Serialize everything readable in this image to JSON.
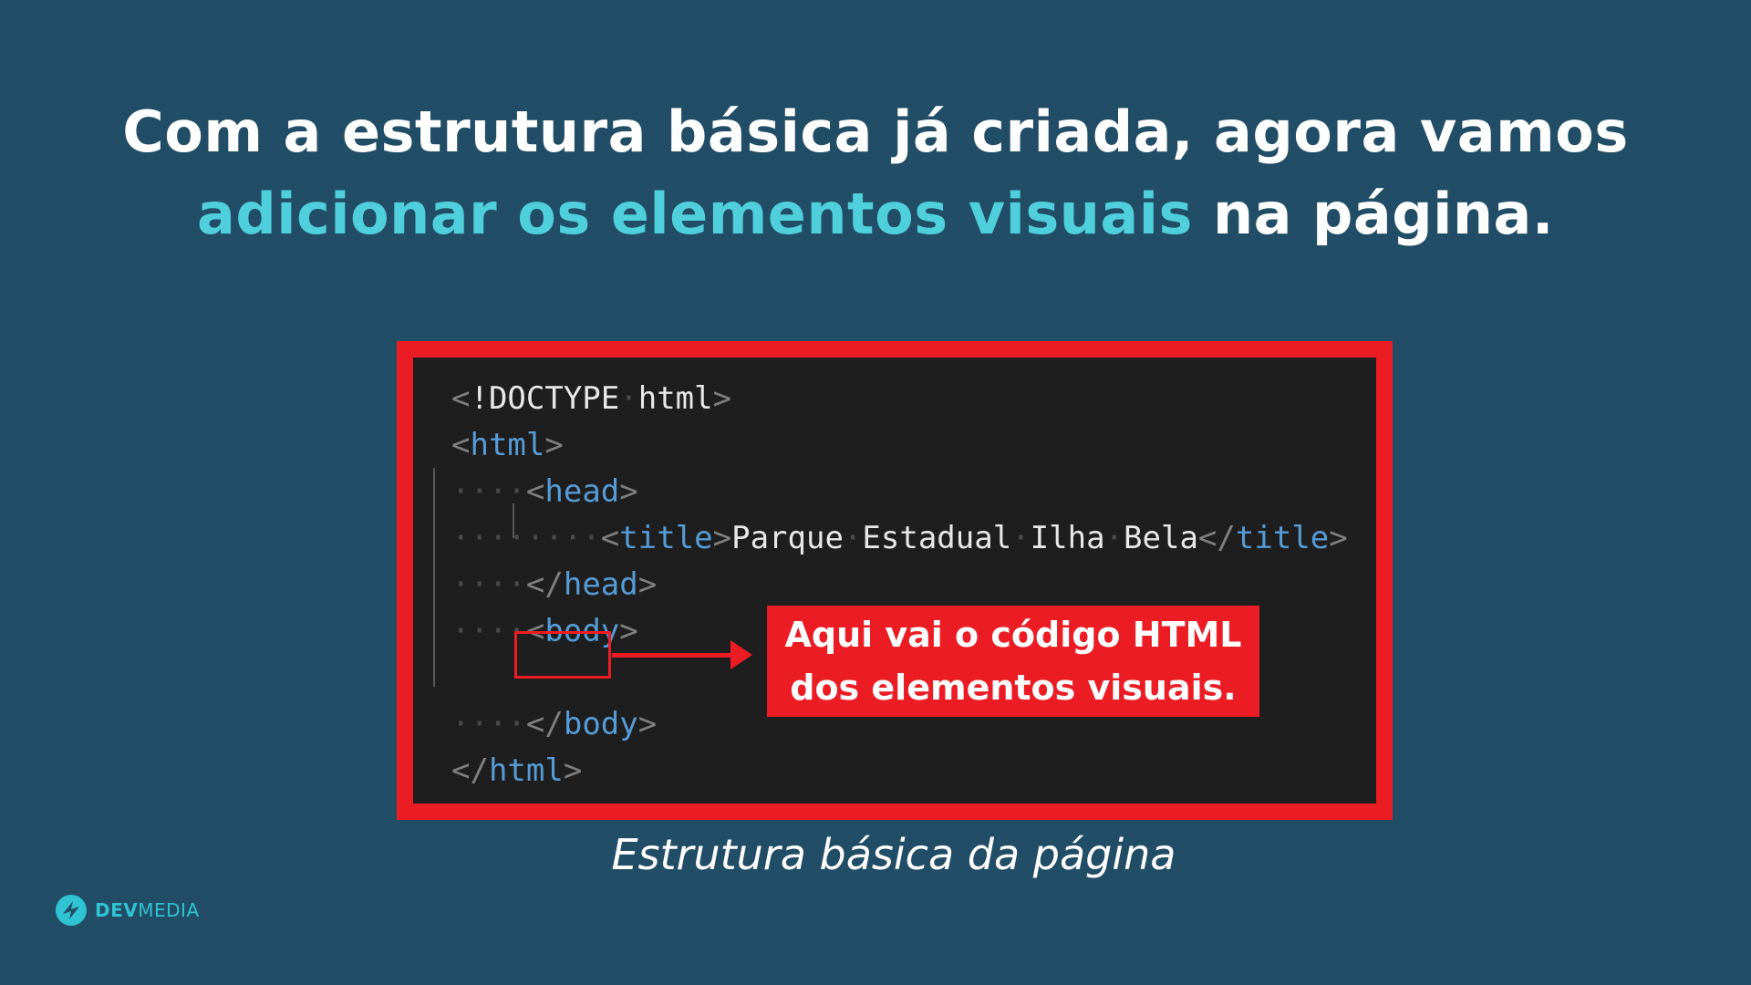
{
  "headline": {
    "line1": "Com a estrutura básica já criada, agora vamos",
    "line2_accent": "adicionar os elementos visuais",
    "line2_rest": " na página."
  },
  "code": {
    "lines": [
      [
        {
          "c": "brk",
          "t": "<"
        },
        {
          "c": "txt",
          "t": "!DOCTYPE"
        },
        {
          "c": "dot",
          "t": "·"
        },
        {
          "c": "txt",
          "t": "html"
        },
        {
          "c": "brk",
          "t": ">"
        }
      ],
      [
        {
          "c": "brk",
          "t": "<"
        },
        {
          "c": "tag",
          "t": "html"
        },
        {
          "c": "brk",
          "t": ">"
        }
      ],
      [
        {
          "c": "dot",
          "t": "····"
        },
        {
          "c": "brk",
          "t": "<"
        },
        {
          "c": "tag",
          "t": "head"
        },
        {
          "c": "brk",
          "t": ">"
        }
      ],
      [
        {
          "c": "dot",
          "t": "········"
        },
        {
          "c": "brk",
          "t": "<"
        },
        {
          "c": "tag",
          "t": "title"
        },
        {
          "c": "brk",
          "t": ">"
        },
        {
          "c": "txt",
          "t": "Parque"
        },
        {
          "c": "dot",
          "t": "·"
        },
        {
          "c": "txt",
          "t": "Estadual"
        },
        {
          "c": "dot",
          "t": "·"
        },
        {
          "c": "txt",
          "t": "Ilha"
        },
        {
          "c": "dot",
          "t": "·"
        },
        {
          "c": "txt",
          "t": "Bela"
        },
        {
          "c": "brk",
          "t": "</"
        },
        {
          "c": "tag",
          "t": "title"
        },
        {
          "c": "brk",
          "t": ">"
        }
      ],
      [
        {
          "c": "dot",
          "t": "····"
        },
        {
          "c": "brk",
          "t": "</"
        },
        {
          "c": "tag",
          "t": "head"
        },
        {
          "c": "brk",
          "t": ">"
        }
      ],
      [
        {
          "c": "dot",
          "t": "····"
        },
        {
          "c": "brk",
          "t": "<"
        },
        {
          "c": "tag",
          "t": "body"
        },
        {
          "c": "brk",
          "t": ">"
        }
      ],
      [],
      [
        {
          "c": "dot",
          "t": "····"
        },
        {
          "c": "brk",
          "t": "</"
        },
        {
          "c": "tag",
          "t": "body"
        },
        {
          "c": "brk",
          "t": ">"
        }
      ],
      [
        {
          "c": "brk",
          "t": "</"
        },
        {
          "c": "tag",
          "t": "html"
        },
        {
          "c": "brk",
          "t": ">"
        }
      ]
    ]
  },
  "callout": {
    "line1": "Aqui vai o código HTML",
    "line2": "dos elementos visuais."
  },
  "caption": "Estrutura básica da página",
  "logo": {
    "bold": "DEV",
    "light": "MEDIA"
  },
  "colors": {
    "background": "#214e66",
    "accent": "#4fcfdc",
    "highlight_red": "#ec1c24",
    "editor_bg": "#1e1e1e",
    "tag_blue": "#569cd6"
  }
}
